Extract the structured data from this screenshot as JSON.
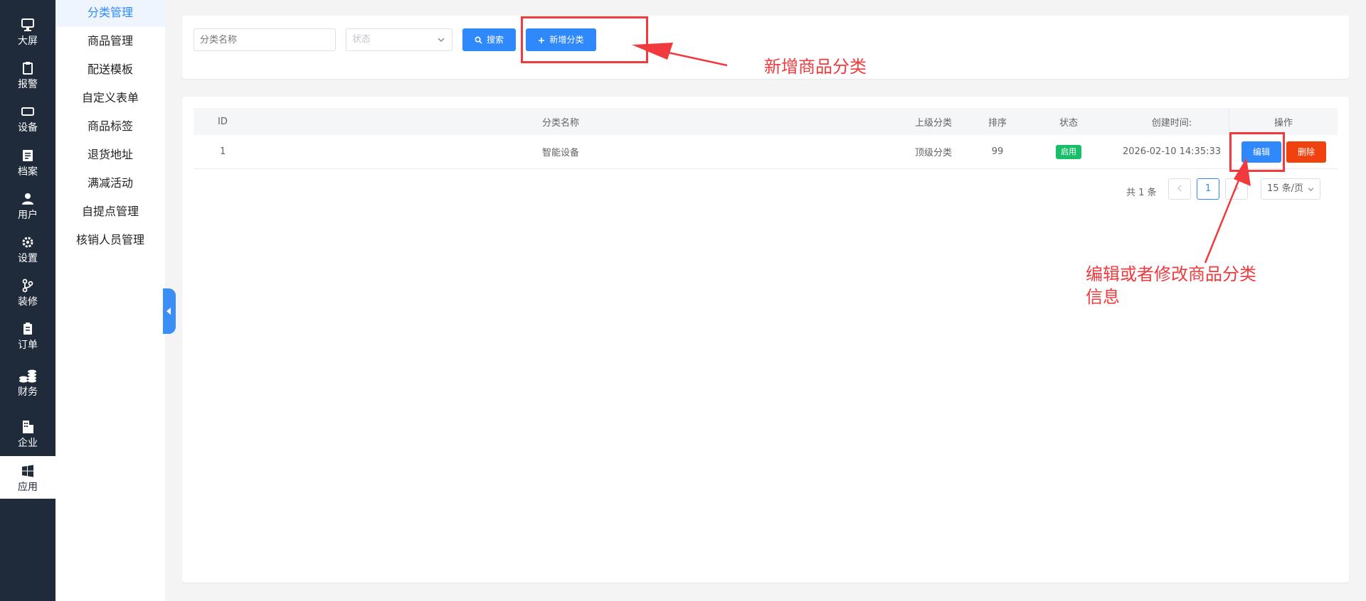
{
  "rail": [
    {
      "label": "大屏",
      "icon": "monitor-icon"
    },
    {
      "label": "报警",
      "icon": "clipboard-icon"
    },
    {
      "label": "设备",
      "icon": "device-icon"
    },
    {
      "label": "档案",
      "icon": "document-icon"
    },
    {
      "label": "用户",
      "icon": "user-icon"
    },
    {
      "label": "设置",
      "icon": "gear-icon"
    },
    {
      "label": "装修",
      "icon": "branch-icon"
    },
    {
      "label": "订单",
      "icon": "order-icon"
    },
    {
      "label": "财务",
      "icon": "coins-icon"
    },
    {
      "label": "企业",
      "icon": "building-icon"
    },
    {
      "label": "应用",
      "icon": "windows-icon"
    }
  ],
  "rail_active": "应用",
  "submenu": [
    "分类管理",
    "商品管理",
    "配送模板",
    "自定义表单",
    "商品标签",
    "退货地址",
    "满减活动",
    "自提点管理",
    "核销人员管理"
  ],
  "submenu_active": "分类管理",
  "filter": {
    "name_placeholder": "分类名称",
    "status_placeholder": "状态",
    "search_label": "搜索",
    "add_label": "新增分类"
  },
  "table": {
    "headers": {
      "id": "ID",
      "name": "分类名称",
      "parent": "上级分类",
      "sort": "排序",
      "status": "状态",
      "created": "创建时间:",
      "ops": "操作"
    },
    "rows": [
      {
        "id": "1",
        "name": "智能设备",
        "parent": "顶级分类",
        "sort": "99",
        "status": "启用",
        "created": "2026-02-10 14:35:33",
        "edit": "编辑",
        "delete": "删除"
      }
    ]
  },
  "pagination": {
    "total": "共 1 条",
    "current": "1",
    "page_size": "15 条/页"
  },
  "annotations": {
    "add": "新增商品分类",
    "edit_line1": "编辑或者修改商品分类",
    "edit_line2": "信息"
  },
  "colors": {
    "primary": "#2f89fc",
    "danger": "#f0420f",
    "success": "#19be6b",
    "annotation": "#f03a3e",
    "rail": "#1f2a3a"
  }
}
